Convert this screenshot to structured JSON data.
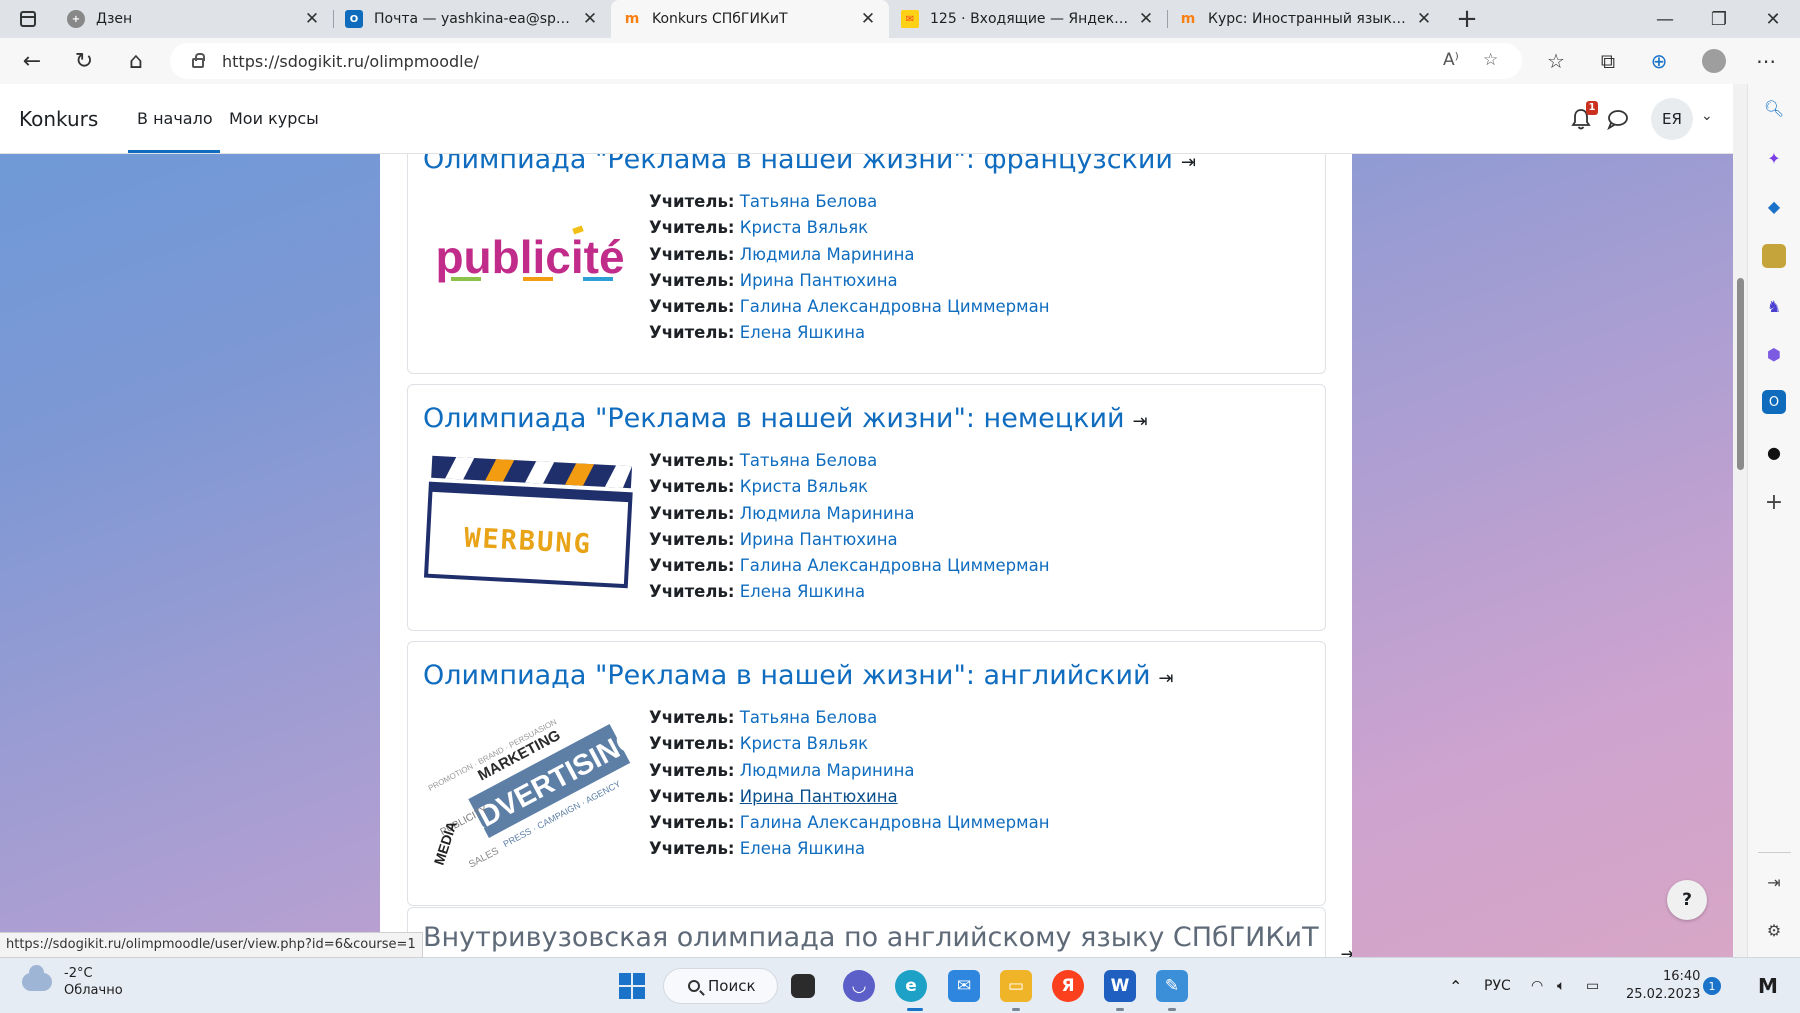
{
  "browser": {
    "tabs": [
      {
        "title": "Дзен",
        "icon": "dzen-icon",
        "color": "#333333"
      },
      {
        "title": "Почта — yashkina-ea@spbgikit.ru",
        "icon": "outlook-icon",
        "color": "#0f6cbd"
      },
      {
        "title": "Konkurs СПбГИКиТ",
        "icon": "moodle-icon",
        "color": "#f98012"
      },
      {
        "title": "125 · Входящие — Яндекс Почта",
        "icon": "yandex-mail-icon",
        "color": "#fc3f1d"
      },
      {
        "title": "Курс: Иностранный язык 1137",
        "icon": "moodle-icon",
        "color": "#f98012"
      }
    ],
    "active_tab": 2,
    "url": "https://sdogikit.ru/olimpmoodle/"
  },
  "moodle": {
    "brand": "Konkurs",
    "nav": [
      "В начало",
      "Мои курсы"
    ],
    "notification_count": "1",
    "user_initials": "ЕЯ"
  },
  "courses": [
    {
      "title": "Олимпиада \"Реклама в нашей жизни\": французский",
      "image": "publicite-logo",
      "image_text": "publicité",
      "teachers": [
        {
          "role": "Учитель:",
          "name": "Татьяна Белова"
        },
        {
          "role": "Учитель:",
          "name": "Криста Вяльяк"
        },
        {
          "role": "Учитель:",
          "name": "Людмила Маринина"
        },
        {
          "role": "Учитель:",
          "name": "Ирина Пантюхина"
        },
        {
          "role": "Учитель:",
          "name": "Галина Александровна Циммерман"
        },
        {
          "role": "Учитель:",
          "name": "Елена Яшкина"
        }
      ]
    },
    {
      "title": "Олимпиада \"Реклама в нашей жизни\": немецкий",
      "image": "werbung-clapperboard",
      "image_text": "WERBUNG",
      "teachers": [
        {
          "role": "Учитель:",
          "name": "Татьяна Белова"
        },
        {
          "role": "Учитель:",
          "name": "Криста Вяльяк"
        },
        {
          "role": "Учитель:",
          "name": "Людмила Маринина"
        },
        {
          "role": "Учитель:",
          "name": "Ирина Пантюхина"
        },
        {
          "role": "Учитель:",
          "name": "Галина Александровна Циммерман"
        },
        {
          "role": "Учитель:",
          "name": "Елена Яшкина"
        }
      ]
    },
    {
      "title": "Олимпиада \"Реклама в нашей жизни\": английский",
      "image": "advertising-word-cloud",
      "image_text": "ADVERTISING",
      "image_words": [
        "MARKETING",
        "MEDIA",
        "PUBLICITY",
        "SALES"
      ],
      "teachers": [
        {
          "role": "Учитель:",
          "name": "Татьяна Белова"
        },
        {
          "role": "Учитель:",
          "name": "Криста Вяльяк"
        },
        {
          "role": "Учитель:",
          "name": "Людмила Маринина"
        },
        {
          "role": "Учитель:",
          "name": "Ирина Пантюхина"
        },
        {
          "role": "Учитель:",
          "name": "Галина Александровна Циммерман"
        },
        {
          "role": "Учитель:",
          "name": "Елена Яшкина"
        }
      ]
    },
    {
      "title": "Внутривузовская олимпиада по английскому языку СПбГИКиТ"
    }
  ],
  "status_bar_url": "https://sdogikit.ru/olimpmoodle/user/view.php?id=6&course=1",
  "help_label": "?",
  "taskbar": {
    "weather_temp": "-2°C",
    "weather_desc": "Облачно",
    "search_label": "Поиск",
    "language": "РУС",
    "time": "16:40",
    "date": "25.02.2023",
    "notifications": "1"
  },
  "colors": {
    "link": "#0f6cbf",
    "accent": "#0f6cbf",
    "badge": "#ca3120"
  }
}
